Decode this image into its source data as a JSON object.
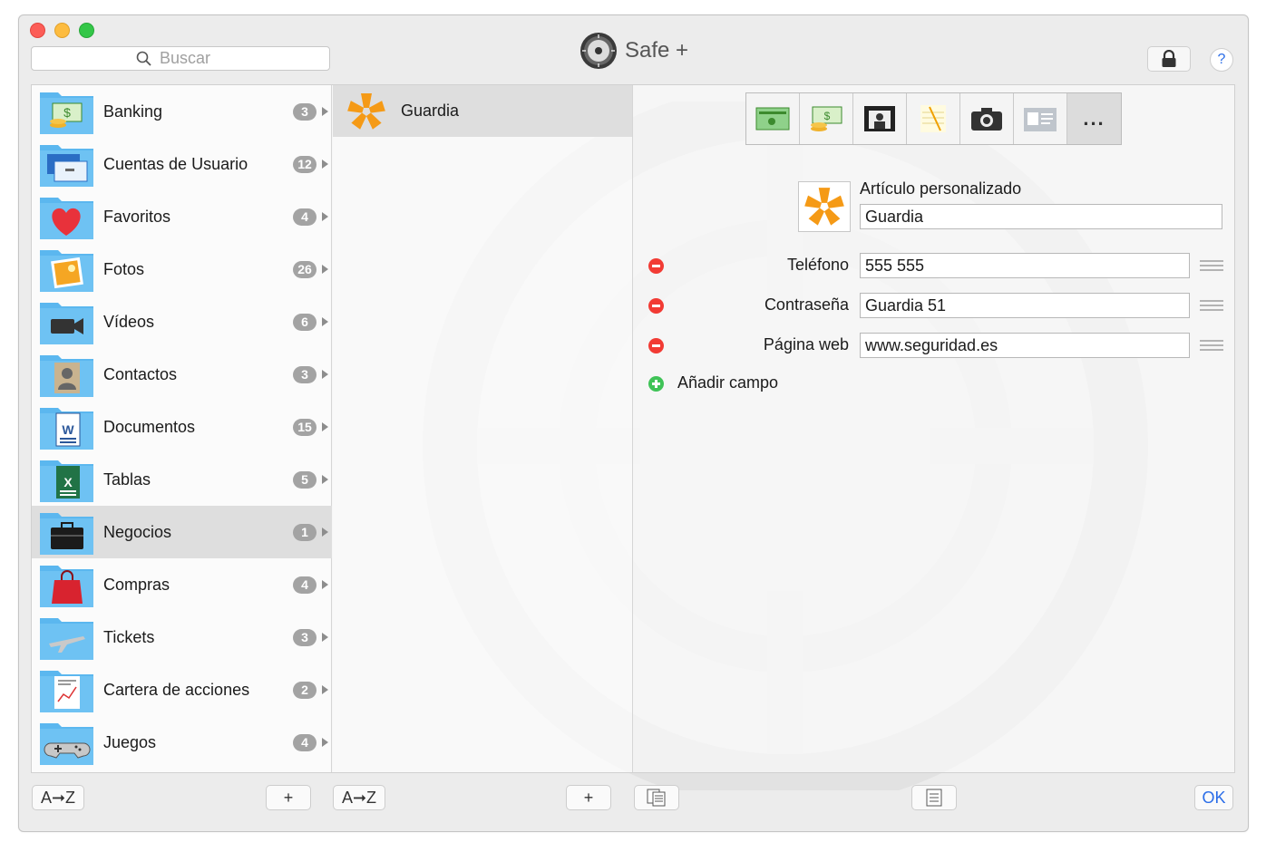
{
  "window": {
    "app_title": "Safe +",
    "search_placeholder": "Buscar"
  },
  "categories": [
    {
      "label": "Banking",
      "count": "3",
      "icon": "money-icon"
    },
    {
      "label": "Cuentas de Usuario",
      "count": "12",
      "icon": "user-accounts-icon"
    },
    {
      "label": "Favoritos",
      "count": "4",
      "icon": "heart-icon"
    },
    {
      "label": "Fotos",
      "count": "26",
      "icon": "photos-icon"
    },
    {
      "label": "Vídeos",
      "count": "6",
      "icon": "video-camera-icon"
    },
    {
      "label": "Contactos",
      "count": "3",
      "icon": "contact-card-icon"
    },
    {
      "label": "Documentos",
      "count": "15",
      "icon": "word-document-icon"
    },
    {
      "label": "Tablas",
      "count": "5",
      "icon": "excel-sheet-icon"
    },
    {
      "label": "Negocios",
      "count": "1",
      "icon": "briefcase-icon",
      "selected": true
    },
    {
      "label": "Compras",
      "count": "4",
      "icon": "shopping-bag-icon"
    },
    {
      "label": "Tickets",
      "count": "3",
      "icon": "airplane-icon"
    },
    {
      "label": "Cartera de acciones",
      "count": "2",
      "icon": "stock-report-icon"
    },
    {
      "label": "Juegos",
      "count": "4",
      "icon": "gamepad-icon"
    }
  ],
  "items": [
    {
      "label": "Guardia",
      "selected": true
    }
  ],
  "detail": {
    "type_label": "Artículo personalizado",
    "title_value": "Guardia",
    "fields": [
      {
        "label": "Teléfono",
        "value": "555 555"
      },
      {
        "label": "Contraseña",
        "value": "Guardia 51"
      },
      {
        "label": "Página web",
        "value": "www.seguridad.es"
      }
    ],
    "add_field_label": "Añadir campo",
    "template_more": "..."
  },
  "bottom": {
    "sort_label": "A➞Z",
    "add_label": "+",
    "ok_label": "OK"
  },
  "colors": {
    "accent": "#2a6de8",
    "folder": "#5bb7ef",
    "item_icon": "#f59a16",
    "remove": "#f23b34",
    "add": "#3fc357"
  }
}
